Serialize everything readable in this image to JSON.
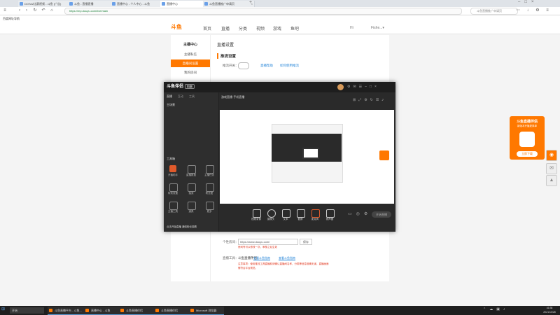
{
  "browser": {
    "tabs": [
      {
        "label": "DOTA2比赛视频 - 斗鱼 (广告)"
      },
      {
        "label": "斗鱼 - 直播直播"
      },
      {
        "label": "直播中心 - 个人中心 - 斗鱼"
      },
      {
        "label": "直播中心"
      },
      {
        "label": "斗鱼直播推广申请页"
      }
    ],
    "url": "https://mp.douyu.com/live/main",
    "search_placeholder": "斗鱼直播推广申请页",
    "bookmark": "百度网址导航"
  },
  "site": {
    "logo": "斗鱼",
    "nav": [
      "首页",
      "直播",
      "分类",
      "视频",
      "游戏",
      "鱼吧"
    ],
    "user": "Hi",
    "username": "Fishe...▾",
    "sidebar": {
      "title": "主播中心",
      "items": [
        "主播私信",
        "直播间设置",
        "我的房间"
      ]
    },
    "main": {
      "page_title": "直播设置",
      "section": "推流设置",
      "toggle_label": "推流开关：",
      "link1": "直播帮助",
      "link2": "如何使用推流",
      "bottom_label": "个性房间：",
      "bottom_url": "https://www.douyu.com/",
      "bottom_btn": "保存",
      "bottom_note": "房间号可以修改一次，审核之后生效",
      "notice_label": "直播工具：",
      "notice_value": "斗鱼直播伴侣",
      "notice_link1": "查看斗鱼指南",
      "notice_link2": "查看斗鱼指南",
      "notice_text": "注意事项：使用推流工具直播前请确认直播间名称、分类等信息准确无误，直播画面需符合平台规范。"
    },
    "promo": {
      "title": "斗鱼直播伴侣",
      "sub": "新版本开播更简单",
      "btn": "立即下载"
    }
  },
  "app": {
    "title": "斗鱼伴侣",
    "badge": "内测",
    "tabs": [
      "直播",
      "互动",
      "工具"
    ],
    "scene": "主场景",
    "preview_title": "游戏直播·手机直播",
    "tools_label": "工具箱",
    "tools": [
      "开播助手",
      "直播数据",
      "主播任务",
      "特效设置",
      "抽奖",
      "粉丝团",
      "主播工具",
      "道具",
      "更多"
    ],
    "bottom": [
      "视频录像",
      "摄像头",
      "文本",
      "截屏",
      "麦克风",
      "扬声器"
    ],
    "footer": "点击开始直播 通知粉丝观看",
    "start_btn": "开始直播"
  },
  "taskbar": {
    "start": "开始",
    "tasks": [
      "斗鱼直播平台 - 斗鱼...",
      "直播中心 - 斗鱼",
      "斗鱼直播伴侣",
      "斗鱼直播伴侣",
      "Microsoft 浏览器"
    ],
    "time": "16:38",
    "date": "2021/10/28"
  },
  "colors": {
    "accent": "#ff7800",
    "link": "#2b88d9",
    "danger": "#e0341b"
  }
}
